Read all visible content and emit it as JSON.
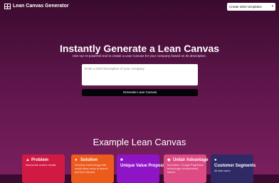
{
  "header": {
    "brand": "Lean Canvas Generator",
    "template_select": "Create other templates"
  },
  "hero": {
    "title": "Instantly Generate a Lean Canvas",
    "subtitle": "Use our AI-powered tool to create a Lean Canvas for your company based on its description.",
    "input_placeholder": "Enter a brief description of your company",
    "button_label": "Generate Lean Canvas"
  },
  "examples": {
    "title": "Example Lean Canvas",
    "cards": [
      {
        "title": "Problem",
        "text": "Inaccurate search results",
        "icon": "warning-icon",
        "color": "#d01a44"
      },
      {
        "title": "Solution",
        "text": "Develop a technology that would allow users to search and find relevant",
        "icon": "lightbulb-icon",
        "color": "#ec5b1b"
      },
      {
        "title": "Unique Value Proposition",
        "text": "",
        "icon": "gift-icon",
        "color": "#8e14c6"
      },
      {
        "title": "Unfair Advantage",
        "text": "Innovation: Google PageRank technology revolutionized search",
        "icon": "diamond-icon",
        "color": "#de4a83"
      },
      {
        "title": "Customer Segments",
        "text": "All web users",
        "icon": "users-icon",
        "color": "#2f2a66"
      }
    ]
  }
}
